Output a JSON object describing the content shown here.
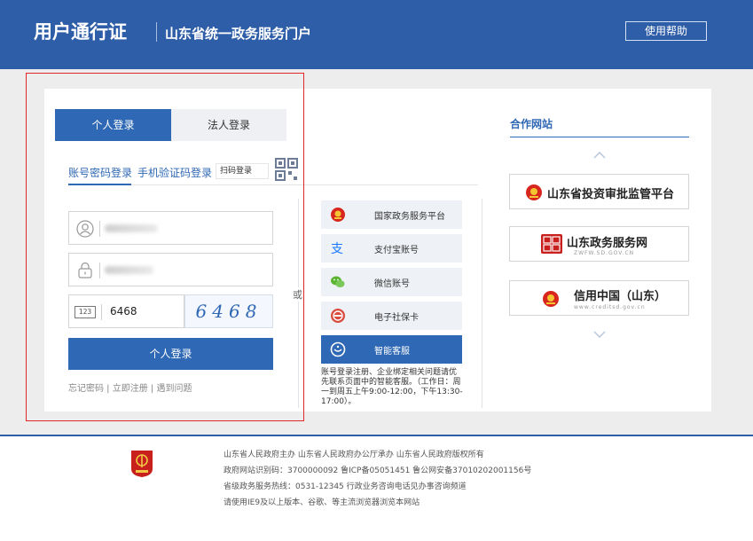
{
  "header": {
    "brand": "用户通行证",
    "subtitle": "山东省统一政务服务门户",
    "help_button": "使用帮助"
  },
  "login": {
    "tabs": [
      "个人登录",
      "法人登录"
    ],
    "active_tab": 0,
    "subtabs": [
      "账号密码登录",
      "手机验证码登录"
    ],
    "scan_login": "扫码登录",
    "captcha_value": "6468",
    "captcha_image_text": "6468",
    "submit_label": "个人登录",
    "links": "忘记密码 | 立即注册 | 遇到问题",
    "or_label": "或"
  },
  "alt_logins": [
    {
      "label": "国家政务服务平台",
      "icon": "national-emblem-icon"
    },
    {
      "label": "支付宝账号",
      "icon": "alipay-icon"
    },
    {
      "label": "微信账号",
      "icon": "wechat-icon"
    },
    {
      "label": "电子社保卡",
      "icon": "social-security-card-icon"
    },
    {
      "label": "智能客服",
      "icon": "chat-service-icon"
    }
  ],
  "notice": "账号登录注册、企业绑定相关问题请优先联系页面中的智能客服。（工作日：周一到周五上午9:00-12:00，下午13:30-17:00）。",
  "partners": {
    "title": "合作网站",
    "items": [
      {
        "label": "山东省投资审批监管平台",
        "subtitle": ""
      },
      {
        "label": "山东政务服务网",
        "subtitle": "ZWFW.SD.GOV.CN"
      },
      {
        "label": "信用中国（山东）",
        "subtitle": "www.creditsd.gov.cn"
      }
    ]
  },
  "footer": {
    "lines": [
      "山东省人民政府主办   山东省人民政府办公厅承办   山东省人民政府版权所有",
      "政府网站识别码：3700000092   鲁ICP备05051451   鲁公网安备37010202001156号",
      "省级政务服务热线：0531-12345   行政业务咨询电话见办事咨询频道",
      "请使用IE9及以上版本、谷歌、等主流浏览器浏览本网站"
    ]
  },
  "colors": {
    "header_bg": "#2f5ea8",
    "accent": "#2f68b4",
    "highlight_border": "#e0262a",
    "page_bg": "#ededed"
  }
}
